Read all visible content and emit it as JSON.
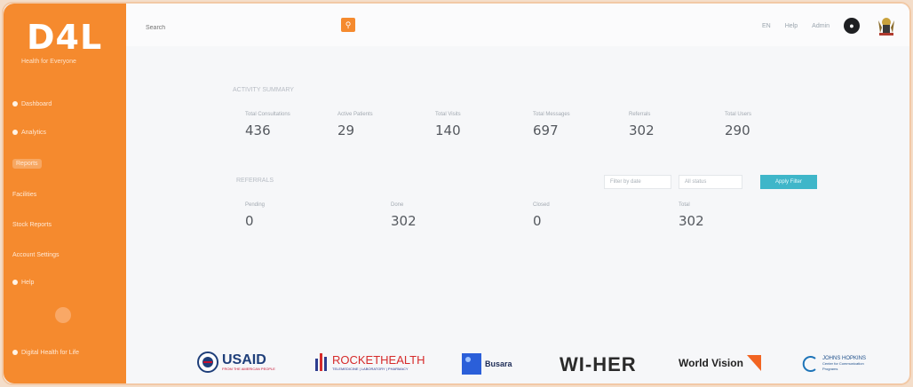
{
  "brand": {
    "logo": "D4L",
    "subtitle": "Health for Everyone"
  },
  "sidebar": {
    "items": [
      {
        "label": "Dashboard",
        "icon": "home-icon"
      },
      {
        "label": "Analytics",
        "icon": "chart-icon"
      },
      {
        "label": "Reports",
        "icon": "report-icon"
      },
      {
        "label": "Facilities",
        "icon": "building-icon"
      },
      {
        "label": "Stock Reports",
        "icon": "box-icon"
      },
      {
        "label": "Account Settings",
        "icon": "gear-icon"
      },
      {
        "label": "Help",
        "icon": "help-icon"
      }
    ],
    "footer_label": "Digital Health for Life"
  },
  "topbar": {
    "search_placeholder": "Search",
    "links": [
      "EN",
      "Help"
    ],
    "user_label": "Admin"
  },
  "summary": {
    "title": "ACTIVITY SUMMARY",
    "stats": [
      {
        "label": "Total Consultations",
        "value": "436"
      },
      {
        "label": "Active Patients",
        "value": "29"
      },
      {
        "label": "Total Visits",
        "value": "140"
      },
      {
        "label": "Total Messages",
        "value": "697"
      },
      {
        "label": "Referrals",
        "value": "302"
      },
      {
        "label": "Total Users",
        "value": "290"
      }
    ]
  },
  "referrals": {
    "title": "REFERRALS",
    "filters": {
      "date": "Filter by date",
      "status": "All status",
      "button": "Apply Filter"
    },
    "stats": [
      {
        "label": "Pending",
        "value": "0"
      },
      {
        "label": "Done",
        "value": "302"
      },
      {
        "label": "Closed",
        "value": "0"
      },
      {
        "label": "Total",
        "value": "302"
      }
    ]
  },
  "partners": {
    "usaid": {
      "name": "USAID",
      "tag": "FROM THE AMERICAN PEOPLE"
    },
    "rocket": {
      "name": "ROCKETHEALTH",
      "tag": "TELEMEDICINE | LABORATORY | PHARMACY"
    },
    "busara": {
      "name": "Busara"
    },
    "wiher": {
      "name": "WI-HER"
    },
    "worldvision": {
      "name": "World Vision"
    },
    "jhu": {
      "name": "JOHNS HOPKINS",
      "tag1": "Center for Communication",
      "tag2": "Programs"
    }
  },
  "colors": {
    "brand_orange": "#f58a2e",
    "accent_teal": "#3fb6c9"
  }
}
